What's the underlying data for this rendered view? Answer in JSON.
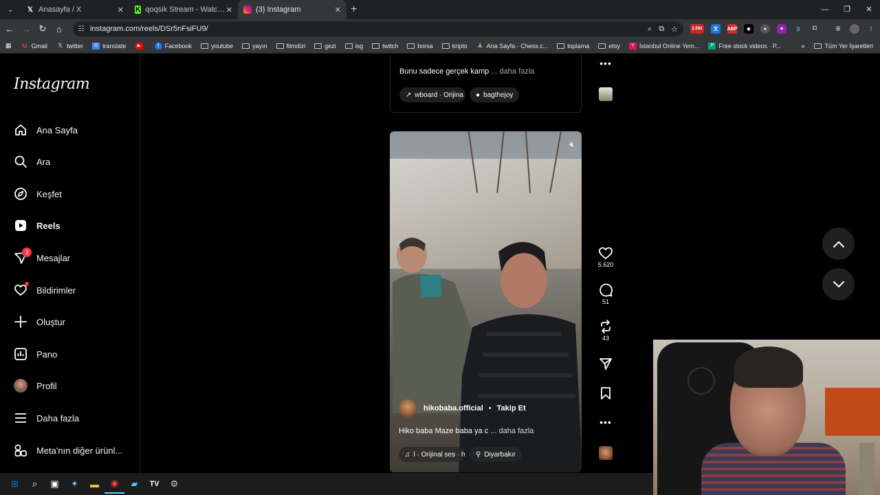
{
  "browser": {
    "tabs": [
      {
        "label": "Anasayfa / X",
        "icon": "x-logo-icon"
      },
      {
        "label": "qoqsik Stream - Watch Live on",
        "icon": "kick-logo-icon"
      },
      {
        "label": "(3) Instagram",
        "icon": "instagram-logo-icon",
        "active": true
      }
    ],
    "url": "instagram.com/reels/DSr5nFsiFU9/",
    "bookmarks": [
      {
        "label": "Gmail",
        "type": "site"
      },
      {
        "label": "twitter",
        "type": "site"
      },
      {
        "label": "translate",
        "type": "site"
      },
      {
        "label": "",
        "type": "youtube"
      },
      {
        "label": "Facebook",
        "type": "site"
      },
      {
        "label": "youtube",
        "type": "folder"
      },
      {
        "label": "yayın",
        "type": "folder"
      },
      {
        "label": "filmdizi",
        "type": "folder"
      },
      {
        "label": "gezi",
        "type": "folder"
      },
      {
        "label": "isg",
        "type": "folder"
      },
      {
        "label": "twitch",
        "type": "folder"
      },
      {
        "label": "borsa",
        "type": "folder"
      },
      {
        "label": "kripto",
        "type": "folder"
      },
      {
        "label": "Ana Sayfa - Chess.c...",
        "type": "site"
      },
      {
        "label": "toplama",
        "type": "folder"
      },
      {
        "label": "etsy",
        "type": "folder"
      },
      {
        "label": "İstanbul Online Yem...",
        "type": "site"
      },
      {
        "label": "Free stock videos · P...",
        "type": "site"
      }
    ],
    "all_bookmarks": "Tüm Yer İşaretleri",
    "ext_badge": "2.592"
  },
  "sidebar": {
    "logo": "Instagram",
    "items": [
      {
        "label": "Ana Sayfa",
        "icon": "home-icon"
      },
      {
        "label": "Ara",
        "icon": "search-icon"
      },
      {
        "label": "Keşfet",
        "icon": "compass-icon"
      },
      {
        "label": "Reels",
        "icon": "reels-icon",
        "bold": true
      },
      {
        "label": "Mesajlar",
        "icon": "messenger-icon",
        "badge": "3"
      },
      {
        "label": "Bildirimler",
        "icon": "heart-icon",
        "dot": true
      },
      {
        "label": "Oluştur",
        "icon": "plus-icon"
      },
      {
        "label": "Pano",
        "icon": "dashboard-icon"
      },
      {
        "label": "Profil",
        "icon": "profile-avatar"
      },
      {
        "label": "Daha fazla",
        "icon": "menu-icon"
      },
      {
        "label": "Meta'nın diğer ürünl...",
        "icon": "meta-apps-icon"
      }
    ]
  },
  "prev_reel": {
    "caption": "Bunu sadece gerçek kamp",
    "more": "... daha fazla",
    "audio": "wboard · Orijina",
    "tag": "bagthejoy"
  },
  "reel": {
    "username": "hikobaba.official",
    "follow": "Takip Et",
    "caption": "Hiko baba Maze baba ya c",
    "more": "... daha fazla",
    "audio": "l · Orijinal ses · h",
    "location": "Diyarbakır",
    "likes": "5.620",
    "comments": "51",
    "reposts": "43"
  },
  "colors": {
    "notification": "#ff3040",
    "background": "#000000",
    "pill": "#1f1f1f"
  }
}
